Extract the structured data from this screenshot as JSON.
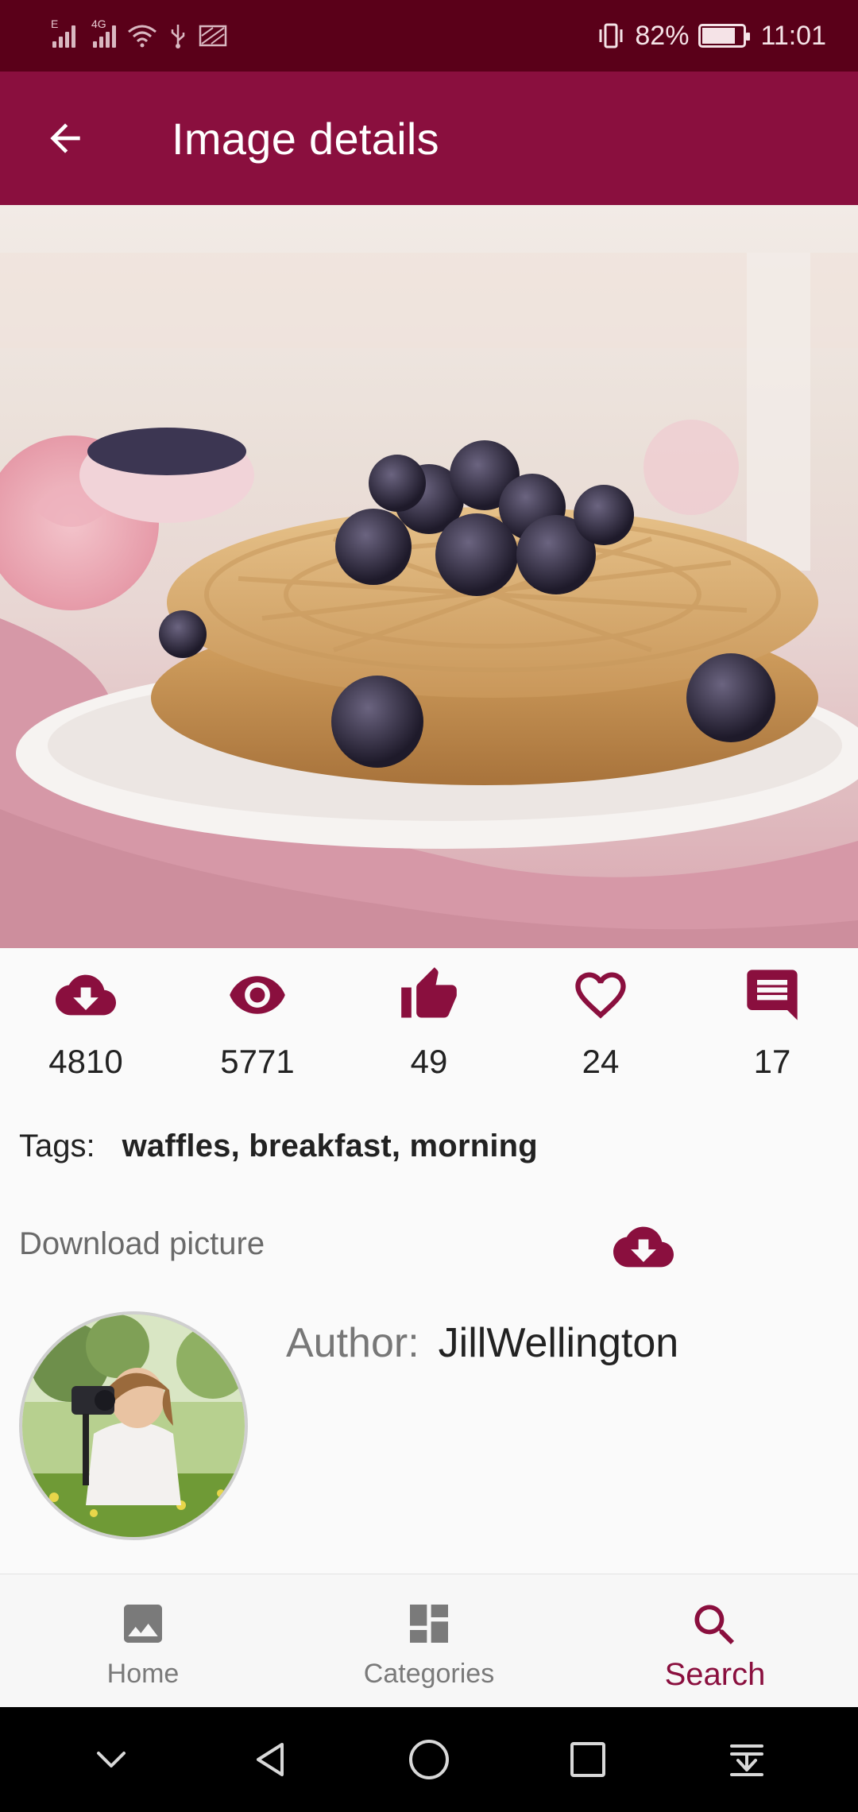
{
  "status_bar": {
    "signal1_label": "E",
    "signal2_label": "4G",
    "battery_text": "82%",
    "battery_level": 0.82,
    "time": "11:01"
  },
  "app_bar": {
    "title": "Image details",
    "back_icon": "arrow-back-icon"
  },
  "stats": [
    {
      "icon": "cloud-download-icon",
      "value": "4810"
    },
    {
      "icon": "eye-icon",
      "value": "5771"
    },
    {
      "icon": "thumbs-up-icon",
      "value": "49"
    },
    {
      "icon": "heart-outline-icon",
      "value": "24"
    },
    {
      "icon": "comment-icon",
      "value": "17"
    }
  ],
  "tags": {
    "label": "Tags:",
    "value": "waffles, breakfast, morning"
  },
  "download": {
    "label": "Download picture",
    "icon": "cloud-download-icon"
  },
  "author": {
    "label": "Author:",
    "name": "JillWellington"
  },
  "bottom_nav": [
    {
      "label": "Home",
      "icon": "image-icon",
      "active": false
    },
    {
      "label": "Categories",
      "icon": "dashboard-icon",
      "active": false
    },
    {
      "label": "Search",
      "icon": "search-icon",
      "active": true
    }
  ],
  "colors": {
    "primary": "#8a0f3e",
    "status_bar": "#5a0019",
    "background": "#fafafa"
  }
}
